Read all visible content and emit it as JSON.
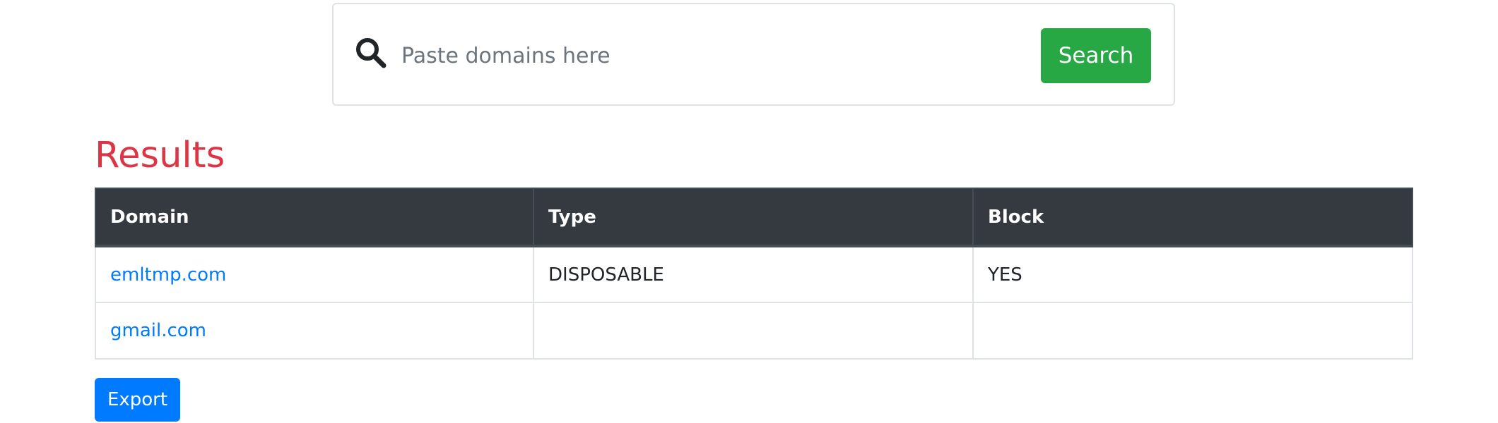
{
  "search": {
    "icon": "search-icon",
    "placeholder": "Paste domains here",
    "value": "",
    "button_label": "Search"
  },
  "results": {
    "heading": "Results",
    "columns": [
      "Domain",
      "Type",
      "Block"
    ],
    "rows": [
      {
        "domain": "emltmp.com",
        "type": "DISPOSABLE",
        "block": "YES"
      },
      {
        "domain": "gmail.com",
        "type": "",
        "block": ""
      }
    ]
  },
  "export_label": "Export",
  "colors": {
    "search_button": "#28a745",
    "heading": "#dc3545",
    "table_header": "#343a40",
    "link": "#007bff",
    "export_button": "#007bff"
  }
}
